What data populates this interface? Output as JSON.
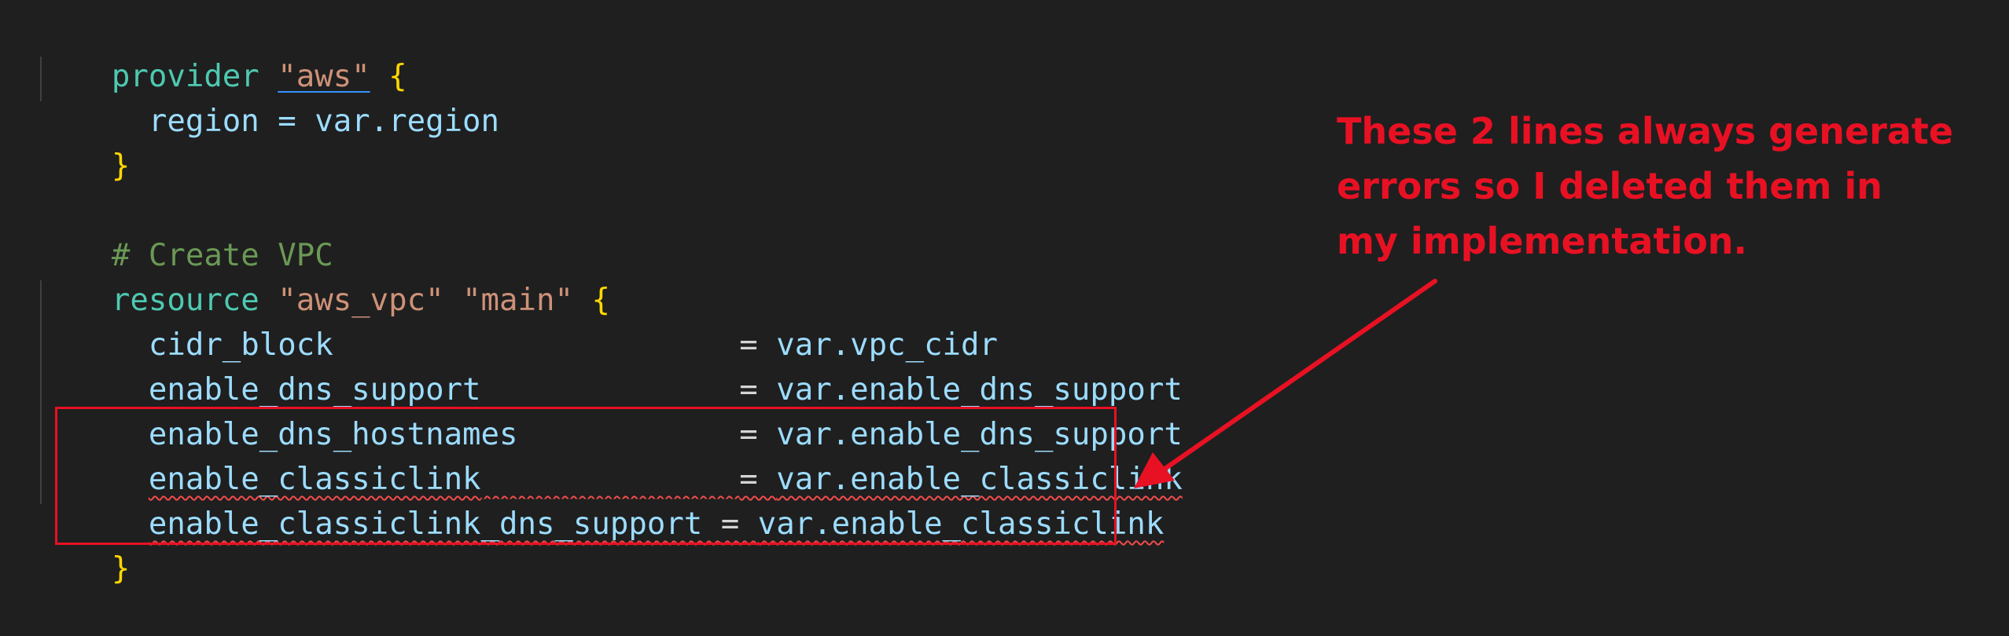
{
  "code": {
    "line1": {
      "kw": "provider",
      "str": "\"aws\"",
      "brace": "{"
    },
    "line2": {
      "text": "region = var.region"
    },
    "line3": {
      "brace": "}"
    },
    "line5": {
      "comment": "# Create VPC"
    },
    "line6": {
      "kw": "resource",
      "str1": "\"aws_vpc\"",
      "str2": "\"main\"",
      "brace": "{"
    },
    "attrs": [
      {
        "name": "cidr_block",
        "pad": "                      ",
        "eq": "= ",
        "value": "var.vpc_cidr"
      },
      {
        "name": "enable_dns_support",
        "pad": "              ",
        "eq": "= ",
        "value": "var.enable_dns_support"
      },
      {
        "name": "enable_dns_hostnames",
        "pad": "            ",
        "eq": "= ",
        "value": "var.enable_dns_support"
      },
      {
        "name": "enable_classiclink",
        "pad": "              ",
        "eq": "= ",
        "value": "var.enable_classiclink"
      },
      {
        "name": "enable_classiclink_dns_support",
        "pad": " ",
        "eq": "= ",
        "value": "var.enable_classiclink"
      }
    ],
    "closing_brace": "}"
  },
  "annotation": {
    "line1": "These 2 lines always generate",
    "line2": "errors so I deleted them in",
    "line3": "my implementation."
  },
  "colors": {
    "background": "#1f1f1f",
    "annotation": "#e81123",
    "error_squiggle": "#f14c4c"
  }
}
